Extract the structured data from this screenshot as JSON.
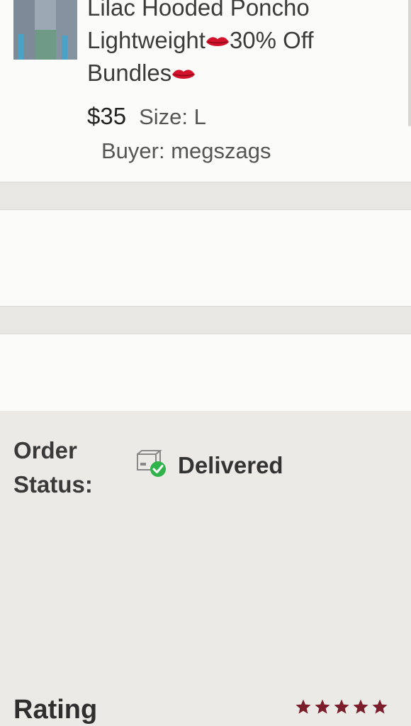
{
  "product": {
    "title_line1": "Lilac Hooded Poncho",
    "title_line2a": "Lightweight",
    "title_line2b": "30% Off",
    "title_line3": "Bundles",
    "price": "$35",
    "size": "Size: L",
    "buyer": "Buyer: megszags",
    "emoji_icon": "lips-emoji"
  },
  "order": {
    "label_line1": "Order",
    "label_line2": "Status:",
    "status": "Delivered",
    "status_icon": "delivered-box-check-icon",
    "status_color": "#2fb34a"
  },
  "rating": {
    "label": "Rating",
    "stars": 5,
    "star_color": "#7b1e2b"
  }
}
